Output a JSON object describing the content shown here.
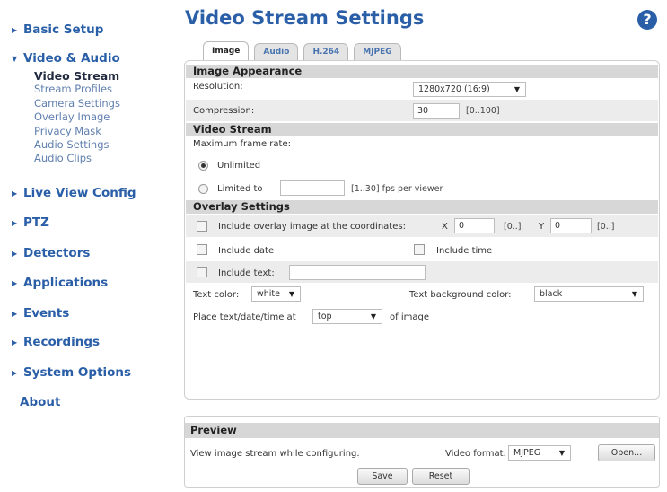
{
  "sidebar": {
    "items": [
      {
        "label": "Basic Setup",
        "arrow": "▶"
      },
      {
        "label": "Video & Audio",
        "arrow": "▼"
      },
      {
        "label": "Live View Config",
        "arrow": "▶"
      },
      {
        "label": "PTZ",
        "arrow": "▶"
      },
      {
        "label": "Detectors",
        "arrow": "▶"
      },
      {
        "label": "Applications",
        "arrow": "▶"
      },
      {
        "label": "Events",
        "arrow": "▶"
      },
      {
        "label": "Recordings",
        "arrow": "▶"
      },
      {
        "label": "System Options",
        "arrow": "▶"
      },
      {
        "label": "About",
        "arrow": ""
      }
    ],
    "subitems": [
      {
        "label": "Video Stream",
        "active": true
      },
      {
        "label": "Stream Profiles"
      },
      {
        "label": "Camera Settings"
      },
      {
        "label": "Overlay Image"
      },
      {
        "label": "Privacy Mask"
      },
      {
        "label": "Audio Settings"
      },
      {
        "label": "Audio Clips"
      }
    ]
  },
  "main": {
    "title": "Video Stream Settings",
    "help_icon": "?",
    "tabs": [
      {
        "label": "Image",
        "active": true
      },
      {
        "label": "Audio"
      },
      {
        "label": "H.264"
      },
      {
        "label": "MJPEG"
      }
    ],
    "image_appearance": {
      "header": "Image Appearance",
      "resolution_label": "Resolution:",
      "resolution_value": "1280x720 (16:9)",
      "compression_label": "Compression:",
      "compression_value": "30",
      "compression_hint": "[0..100]"
    },
    "video_stream": {
      "header": "Video Stream",
      "max_frame_rate_label": "Maximum frame rate:",
      "unlimited_label": "Unlimited",
      "limited_label": "Limited to",
      "limited_value": "",
      "limited_hint": "[1..30] fps per viewer"
    },
    "overlay": {
      "header": "Overlay Settings",
      "include_overlay_label": "Include overlay image at the coordinates:",
      "x_label": "X",
      "x_value": "0",
      "x_hint": "[0..]",
      "y_label": "Y",
      "y_value": "0",
      "y_hint": "[0..]",
      "include_date_label": "Include date",
      "include_time_label": "Include time",
      "include_text_label": "Include text:",
      "include_text_value": "",
      "text_color_label": "Text color:",
      "text_color_value": "white",
      "text_bg_color_label": "Text background color:",
      "text_bg_color_value": "black",
      "place_label": "Place text/date/time at",
      "place_value": "top",
      "place_suffix": "of image"
    },
    "preview": {
      "header": "Preview",
      "view_text": "View image stream while configuring.",
      "video_format_label": "Video format:",
      "video_format_value": "MJPEG",
      "open_label": "Open..."
    },
    "save_label": "Save",
    "reset_label": "Reset",
    "dropdown_arrow": "▼"
  }
}
